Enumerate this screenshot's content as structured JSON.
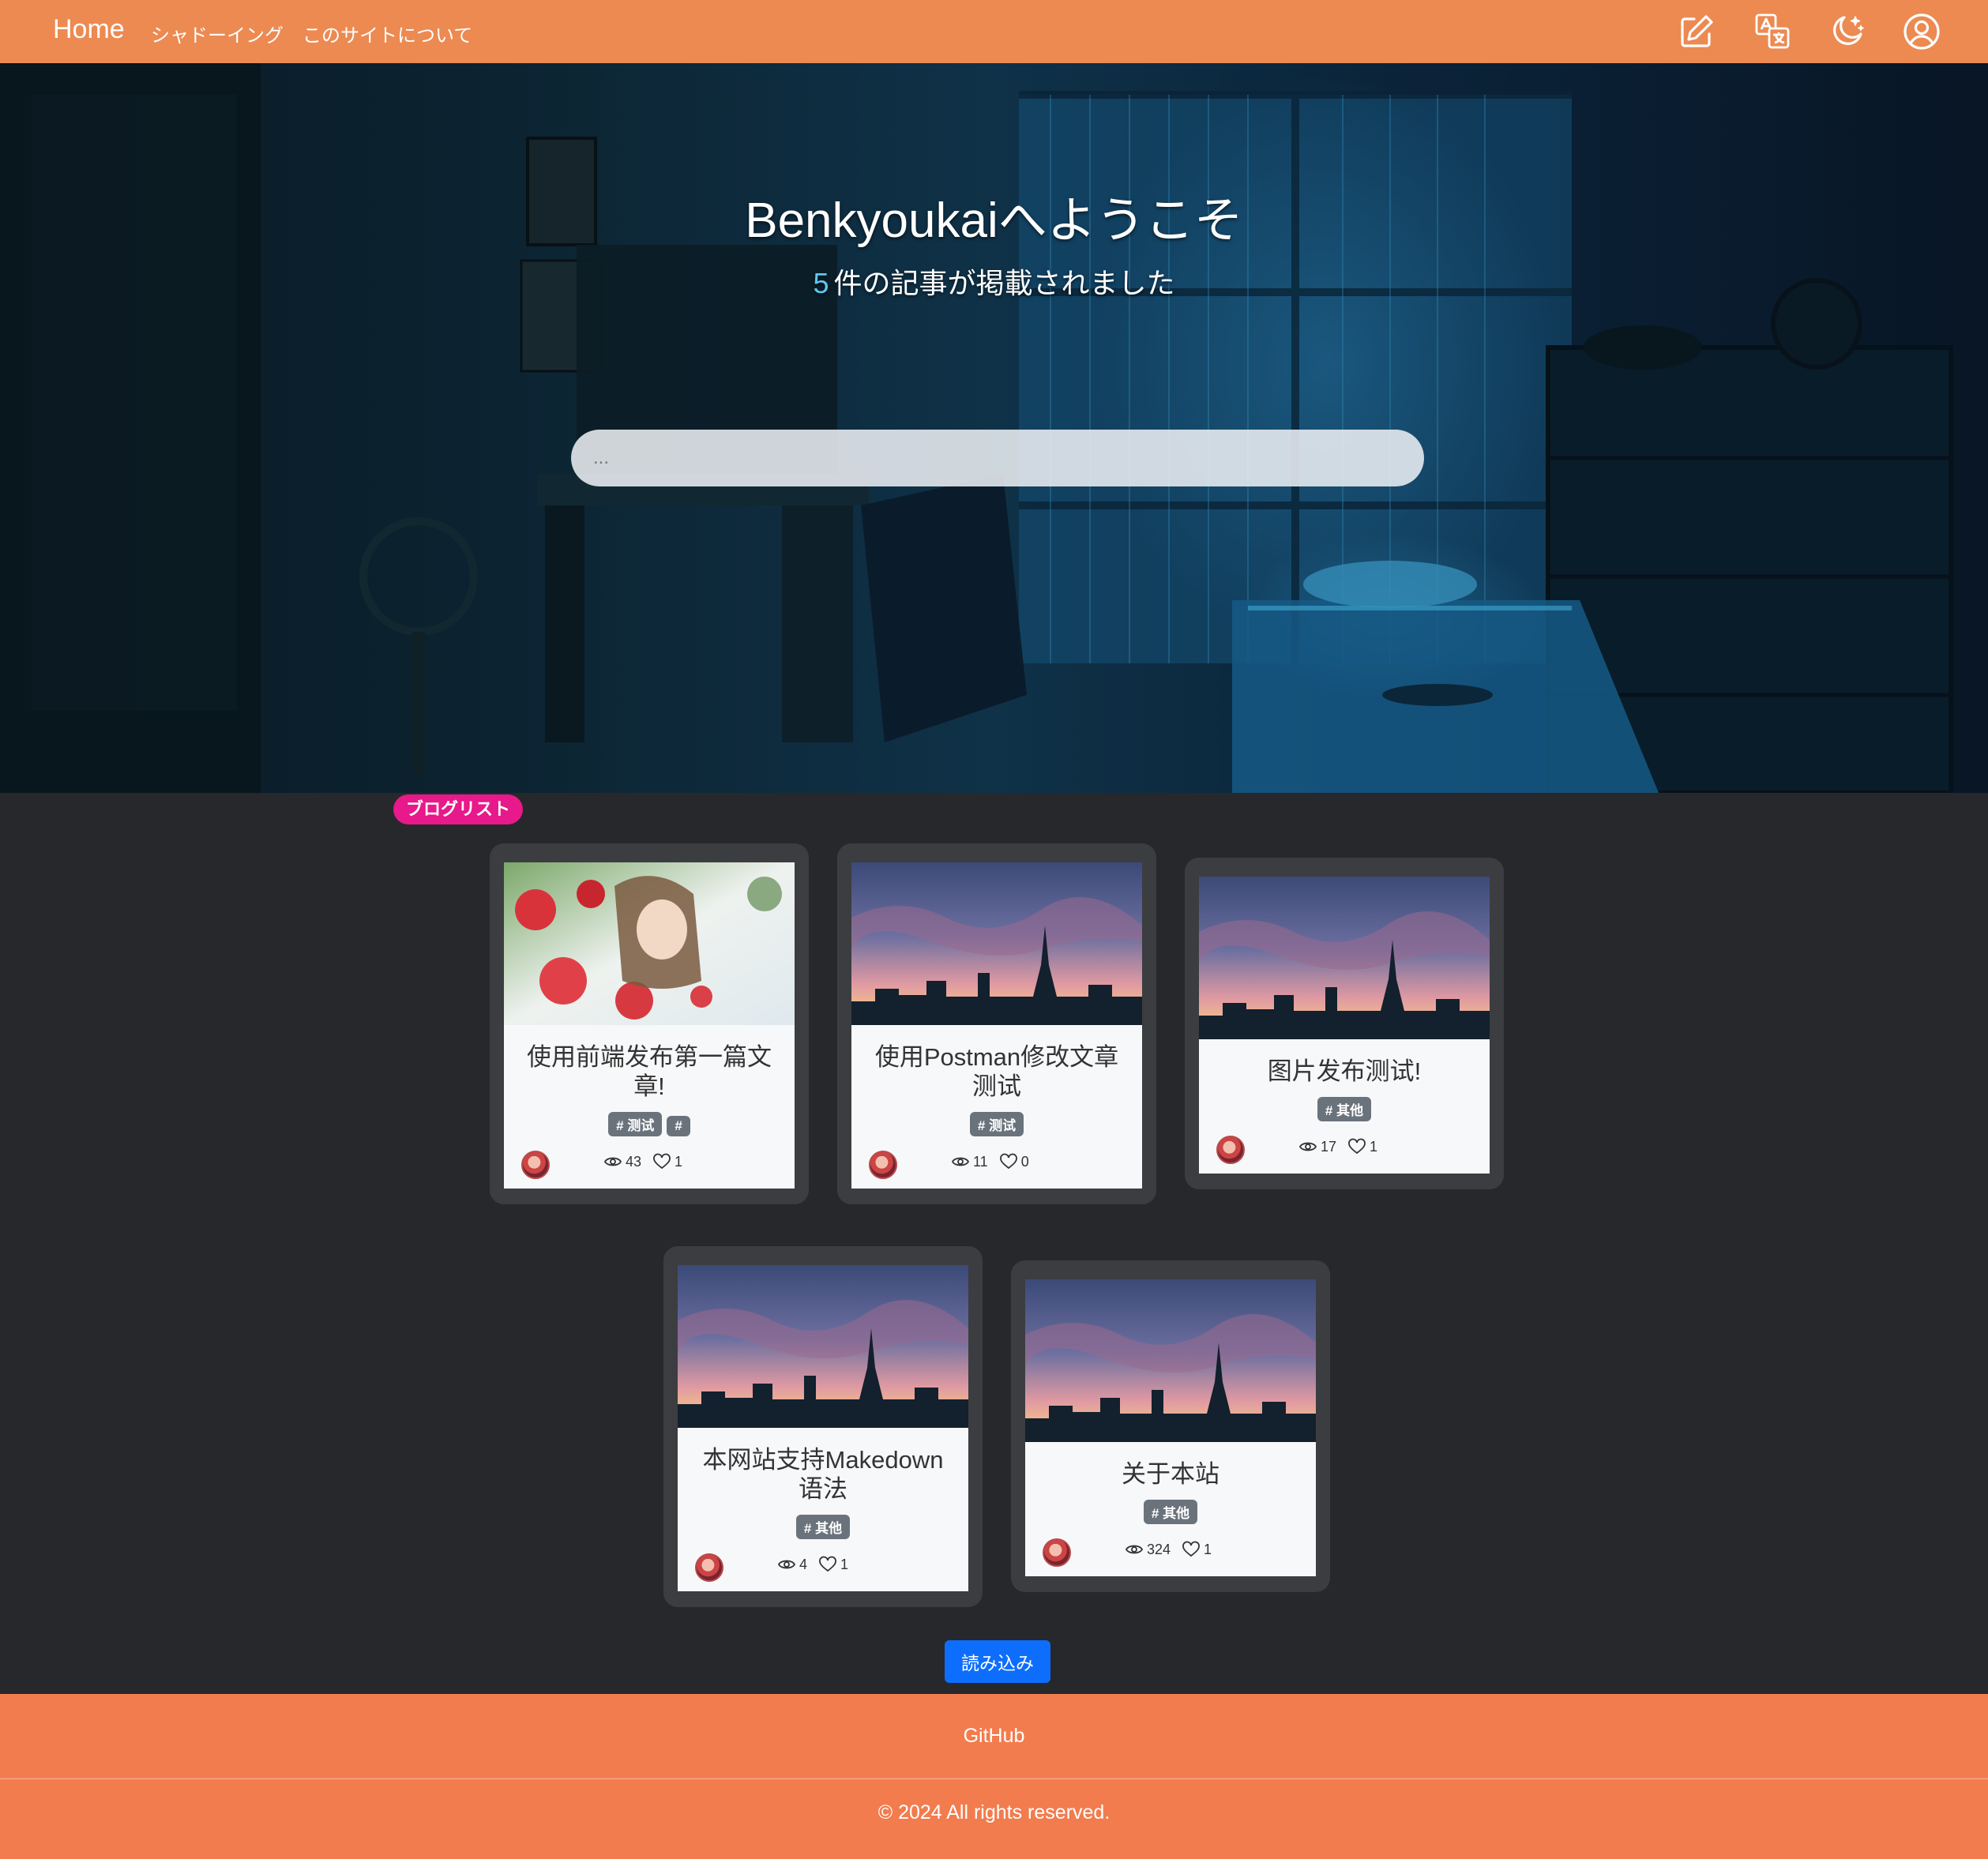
{
  "nav": {
    "brand": "Home",
    "links": [
      "シャドーイング",
      "このサイトについて"
    ],
    "icons": [
      "edit-icon",
      "translate-icon",
      "dark-mode-icon",
      "user-icon"
    ]
  },
  "hero": {
    "title": "Benkyoukaiへようこそ",
    "count": "5",
    "subtitle": "件の記事が掲載されました",
    "search_placeholder": "..."
  },
  "section_badge": "ブログリスト",
  "cards": [
    {
      "title": "使用前端发布第一篇文章!",
      "tags": [
        "# 测试",
        "#"
      ],
      "views": "43",
      "likes": "1",
      "image": "flowers"
    },
    {
      "title": "使用Postman修改文章测试",
      "tags": [
        "# 测试"
      ],
      "views": "11",
      "likes": "0",
      "image": "sky"
    },
    {
      "title": "图片发布测试!",
      "tags": [
        "# 其他"
      ],
      "views": "17",
      "likes": "1",
      "image": "sky"
    },
    {
      "title": "本网站支持Makedown语法",
      "tags": [
        "# 其他"
      ],
      "views": "4",
      "likes": "1",
      "image": "sky"
    },
    {
      "title": "关于本站",
      "tags": [
        "# 其他"
      ],
      "views": "324",
      "likes": "1",
      "image": "sky"
    }
  ],
  "load_more": "読み込み",
  "footer": {
    "link": "GitHub",
    "copyright": "© 2024 All rights reserved."
  },
  "colors": {
    "navbar": "#ec8a52",
    "footer": "#f27c4e",
    "badge": "#e8198a",
    "button": "#0d6efd",
    "page_bg": "#26282c",
    "card_frame": "#3c3d40"
  }
}
